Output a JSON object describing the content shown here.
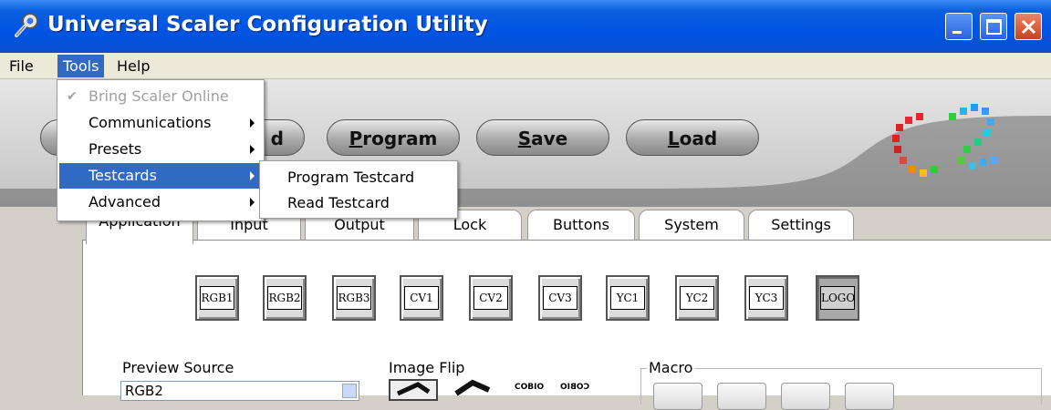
{
  "window": {
    "title": "Universal Scaler Configuration Utility"
  },
  "menubar": {
    "items": [
      "File",
      "Tools",
      "Help"
    ]
  },
  "tools_menu": {
    "items": [
      {
        "label": "Bring Scaler Online",
        "disabled": true,
        "checked": true
      },
      {
        "label": "Communications",
        "submenu": true
      },
      {
        "label": "Presets",
        "submenu": true
      },
      {
        "label": "Testcards",
        "submenu": true,
        "highlighted": true
      },
      {
        "label": "Advanced",
        "submenu": true
      }
    ]
  },
  "testcards_submenu": {
    "items": [
      "Program Testcard",
      "Read Testcard"
    ]
  },
  "toolbar": {
    "read_suffix": "d",
    "program": {
      "accel": "P",
      "rest": "rogram"
    },
    "save": {
      "accel": "S",
      "rest": "ave"
    },
    "load": {
      "accel": "L",
      "rest": "oad"
    }
  },
  "tabs": [
    "Application",
    "Input",
    "Output",
    "Lock",
    "Buttons",
    "System",
    "Settings"
  ],
  "sources": [
    "RGB1",
    "RGB2",
    "RGB3",
    "CV1",
    "CV2",
    "CV3",
    "YC1",
    "YC2",
    "YC3",
    "LOGO"
  ],
  "preview_source": {
    "label": "Preview Source",
    "value": "RGB2"
  },
  "image_flip": {
    "label": "Image Flip",
    "logo_text": "COBIO"
  },
  "macro": {
    "label": "Macro"
  },
  "colors": {
    "accent": "#316ac5",
    "titlebar": "#0054e3"
  }
}
